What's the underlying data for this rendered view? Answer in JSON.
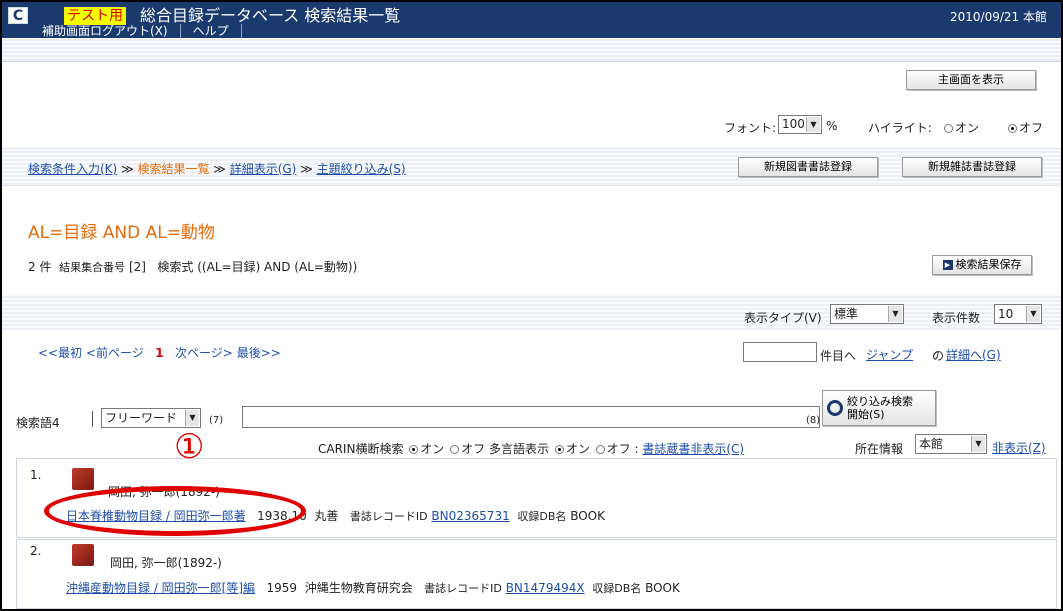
{
  "header": {
    "logo": "C",
    "test_label": "テスト用",
    "title": "総合目録データベース 検索結果一覧",
    "date_branch": "2010/09/21 本館",
    "nav": [
      "補助画面ログアウト(X)",
      "ヘルプ"
    ]
  },
  "main_screen_button": "主画面を表示",
  "display_options": {
    "font_label": "フォント:",
    "font_value": "100",
    "font_unit": "%",
    "highlight_label": "ハイライト:",
    "on_label": "オン",
    "off_label": "オフ",
    "highlight_selected": "off"
  },
  "breadcrumb": {
    "items": [
      "検索条件入力(K)",
      "検索結果一覧",
      "詳細表示(G)",
      "主題絞り込み(S)"
    ],
    "separator": "≫"
  },
  "register_buttons": [
    "新規図書書誌登録",
    "新規雑誌書誌登録"
  ],
  "query": {
    "heading": "AL=目録 AND AL=動物",
    "count": "2",
    "count_unit": "件",
    "set_label": "結果集合番号",
    "set_number": "[2]",
    "expr_label": "検索式",
    "expr": "((AL=目録) AND (AL=動物))"
  },
  "save_button": "検索結果保存",
  "view": {
    "type_label": "表示タイプ(V)",
    "type_value": "標準",
    "count_label": "表示件数",
    "count_value": "10"
  },
  "pager": {
    "first": "<<最初",
    "prev": "<前ページ",
    "current": "1",
    "next": "次ページ>",
    "last": "最後>>",
    "jump_suffix": "件目へ",
    "jump_link": "ジャンプ",
    "detail_prefix": "の",
    "detail_link": "詳細へ(G)"
  },
  "refine": {
    "label": "検索語4",
    "field_value": "フリーワード",
    "key7": "(7)",
    "key8": "(8)",
    "button": "絞り込み検索\n開始(S)"
  },
  "options_row": {
    "carin_label": "CARIN横断検索",
    "multi_label": "多言語表示",
    "on": "オン",
    "off": "オフ",
    "colon": ":",
    "holdings_link": "書誌蔵書非表示(C)",
    "location_label": "所在情報",
    "location_value": "本館",
    "hide_link": "非表示(Z)"
  },
  "annotation": {
    "number": "①"
  },
  "results": [
    {
      "num": "1.",
      "author": "岡田, 弥一郎(1892-)",
      "title": "日本脊椎動物目録 / 岡田弥一郎著",
      "year": "1938.10",
      "publisher": "丸善",
      "record_label": "書誌レコードID",
      "record_id": "BN02365731",
      "db_label": "収録DB名",
      "db": "BOOK"
    },
    {
      "num": "2.",
      "author": "岡田, 弥一郎(1892-)",
      "title": "沖縄産動物目録 / 岡田弥一郎[等]編",
      "year": "1959",
      "publisher": "沖縄生物教育研究会",
      "record_label": "書誌レコードID",
      "record_id": "BN1479494X",
      "db_label": "収録DB名",
      "db": "BOOK"
    }
  ],
  "colors": {
    "header_bg": "#1a3a6e",
    "accent_orange": "#e56b0c",
    "link_blue": "#1e4fa8",
    "annotation_red": "#e00000"
  }
}
